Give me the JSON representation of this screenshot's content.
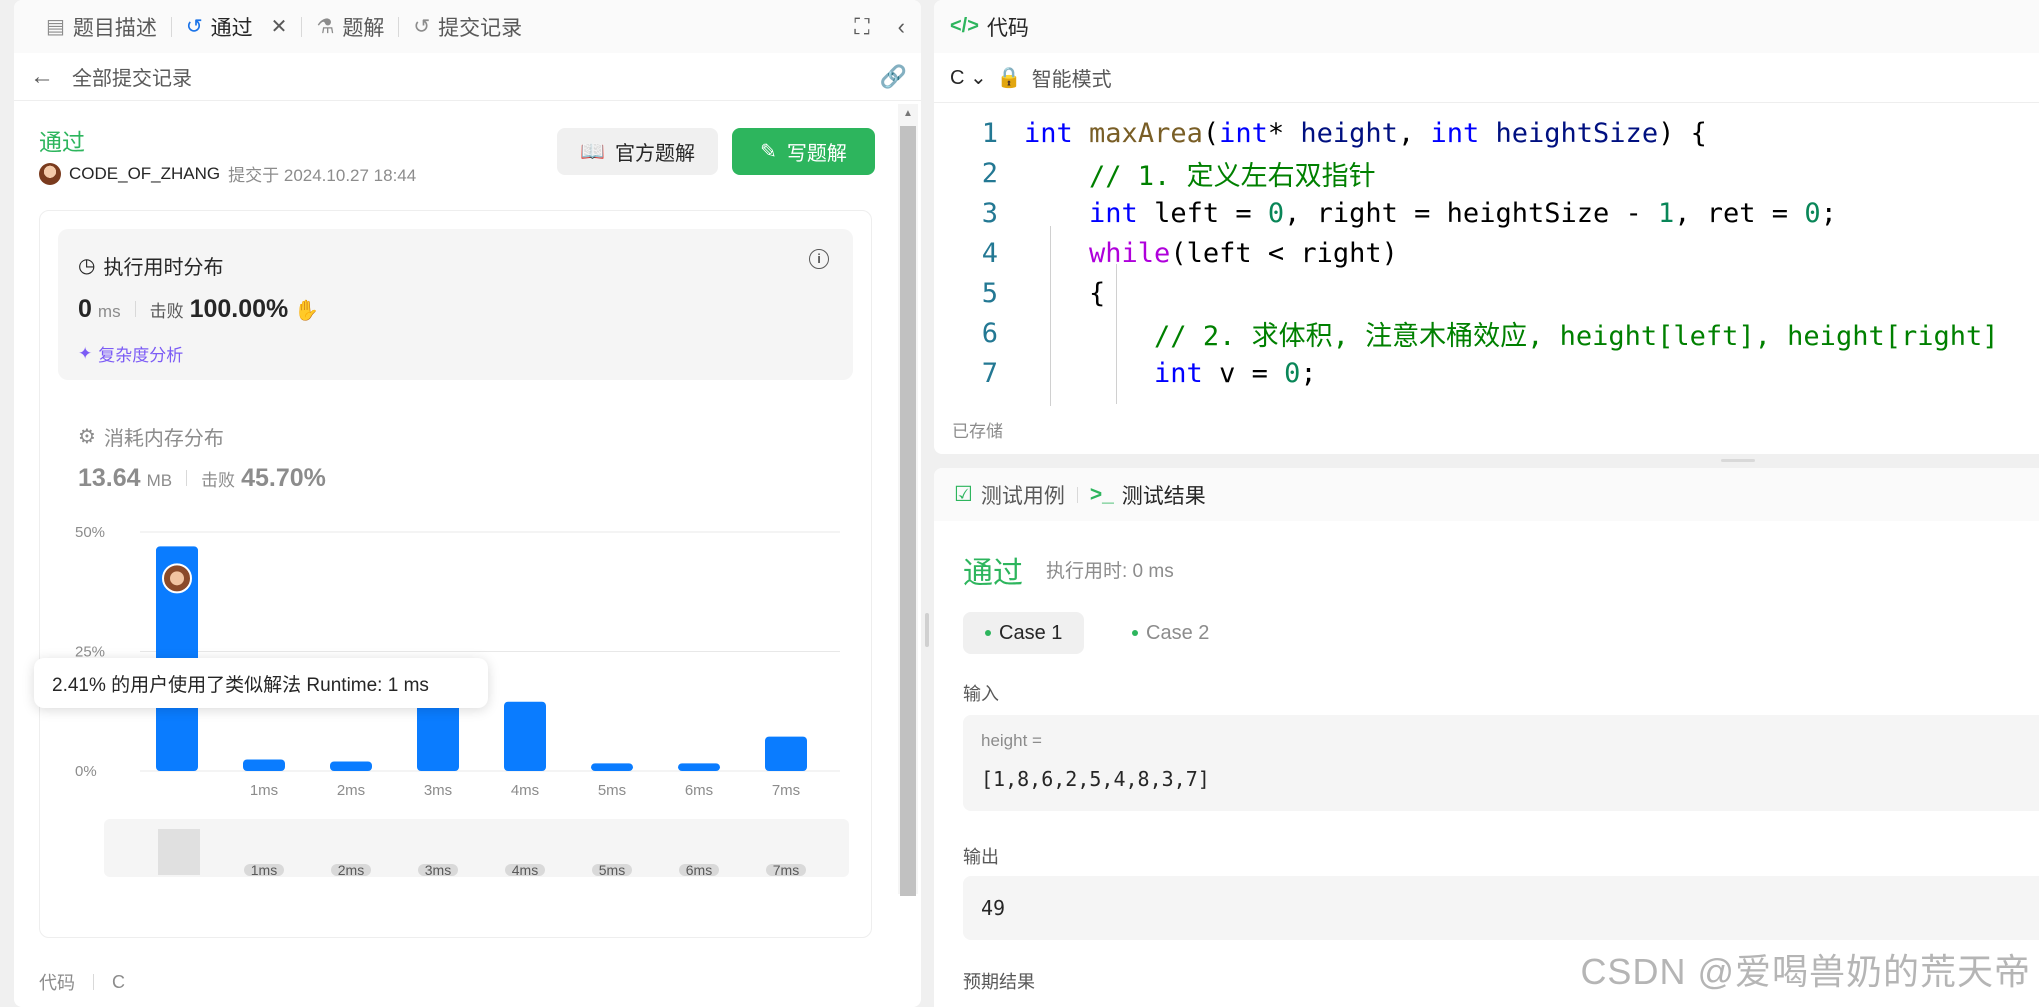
{
  "left": {
    "tabs": [
      {
        "label": "题目描述",
        "icon": "document-icon"
      },
      {
        "label": "通过",
        "icon": "history-icon"
      },
      {
        "label": "题解",
        "icon": "flask-icon"
      },
      {
        "label": "提交记录",
        "icon": "history-icon"
      }
    ],
    "back_label": "全部提交记录",
    "status": "通过",
    "user": "CODE_OF_ZHANG",
    "submitted": "提交于 2024.10.27 18:44",
    "btn_official": "官方题解",
    "btn_write": "写题解",
    "runtime": {
      "title": "执行用时分布",
      "value": "0",
      "unit": "ms",
      "beat_label": "击败",
      "beat_value": "100.00%",
      "complexity": "复杂度分析"
    },
    "memory": {
      "title": "消耗内存分布",
      "value": "13.64",
      "unit": "MB",
      "beat_label": "击败",
      "beat_value": "45.70%"
    },
    "tooltip": "2.41% 的用户使用了类似解法 Runtime: 1 ms",
    "code_label": "代码",
    "code_lang": "C"
  },
  "chart_data": {
    "type": "bar",
    "categories": [
      "0ms",
      "1ms",
      "2ms",
      "3ms",
      "4ms",
      "5ms",
      "6ms",
      "7ms"
    ],
    "tick_labels": [
      "",
      "1ms",
      "2ms",
      "3ms",
      "4ms",
      "5ms",
      "6ms",
      "7ms"
    ],
    "values": [
      47,
      2.41,
      2,
      17,
      14.5,
      1.6,
      1.6,
      7.2
    ],
    "y_ticks": [
      "0%",
      "25%",
      "50%"
    ],
    "ylim": [
      0,
      50
    ],
    "bar_color": "#0a7cff",
    "highlight_index": 0
  },
  "editor": {
    "title": "代码",
    "lang": "C",
    "mode": "智能模式",
    "saved": "已存储"
  },
  "tests": {
    "tab1": "测试用例",
    "tab2": "测试结果",
    "status": "通过",
    "runtime": "执行用时: 0 ms",
    "case1": "Case 1",
    "case2": "Case 2",
    "input_label": "输入",
    "input_key": "height =",
    "input_value": "[1,8,6,2,5,4,8,3,7]",
    "output_label": "输出",
    "output_value": "49",
    "expected_label": "预期结果"
  },
  "watermark": "CSDN @爱喝兽奶的荒天帝",
  "colors": {
    "accent_green": "#2db55d",
    "bar_blue": "#0a7cff"
  }
}
